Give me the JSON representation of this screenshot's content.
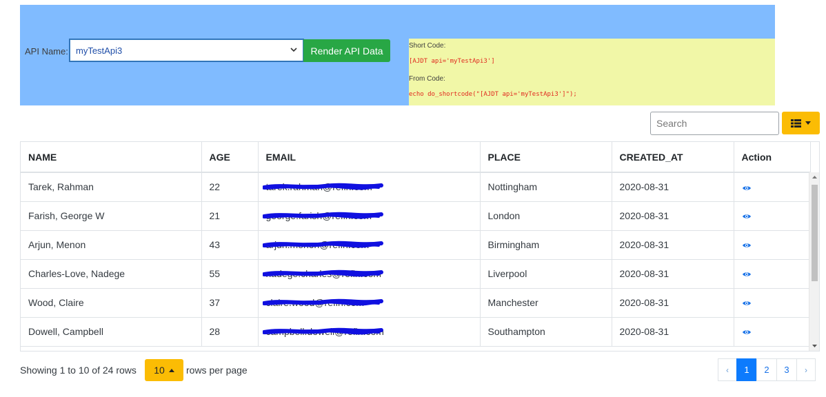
{
  "api_panel": {
    "label": "API Name:",
    "selected_api": "myTestApi3",
    "render_button": "Render API Data",
    "short_code_label": "Short Code:",
    "short_code_value": "[AJDT api='myTestApi3']",
    "from_code_label": "From Code:",
    "from_code_value": "echo do_shortcode(\"[AJDT api='myTestApi3']\");"
  },
  "toolbar": {
    "search_placeholder": "Search",
    "columns_icon": "list-icon"
  },
  "table": {
    "headers": [
      "NAME",
      "AGE",
      "EMAIL",
      "PLACE",
      "CREATED_AT",
      "Action"
    ],
    "rows": [
      {
        "name": "Tarek, Rahman",
        "age": "22",
        "email": "tarek.rahman@refin.com",
        "place": "Nottingham",
        "created_at": "2020-08-31"
      },
      {
        "name": "Farish, George W",
        "age": "21",
        "email": "george.farish@refin.com",
        "place": "London",
        "created_at": "2020-08-31"
      },
      {
        "name": "Arjun, Menon",
        "age": "43",
        "email": "arjun.menon@refin.com",
        "place": "Birmingham",
        "created_at": "2020-08-31"
      },
      {
        "name": "Charles-Love, Nadege",
        "age": "55",
        "email": "nadege.charles@refin.com",
        "place": "Liverpool",
        "created_at": "2020-08-31"
      },
      {
        "name": "Wood, Claire",
        "age": "37",
        "email": "claire.wood@refin.com",
        "place": "Manchester",
        "created_at": "2020-08-31"
      },
      {
        "name": "Dowell, Campbell",
        "age": "28",
        "email": "campbell.dowell@refin.com",
        "place": "Southampton",
        "created_at": "2020-08-31"
      }
    ],
    "action_icon": "eye-icon"
  },
  "footer": {
    "showing_text": "Showing 1 to 10 of 24 rows",
    "page_size": "10",
    "rows_per_page_text": "rows per page",
    "prev": "‹",
    "next": "›",
    "pages": [
      "1",
      "2",
      "3"
    ],
    "active_page": "1"
  },
  "colors": {
    "panel_blue": "#80bbff",
    "code_yellow": "#f1f7a7",
    "render_green": "#28a745",
    "accent_yellow": "#fbbc04",
    "page_active": "#0d7bfd",
    "redaction": "#1010e0"
  }
}
